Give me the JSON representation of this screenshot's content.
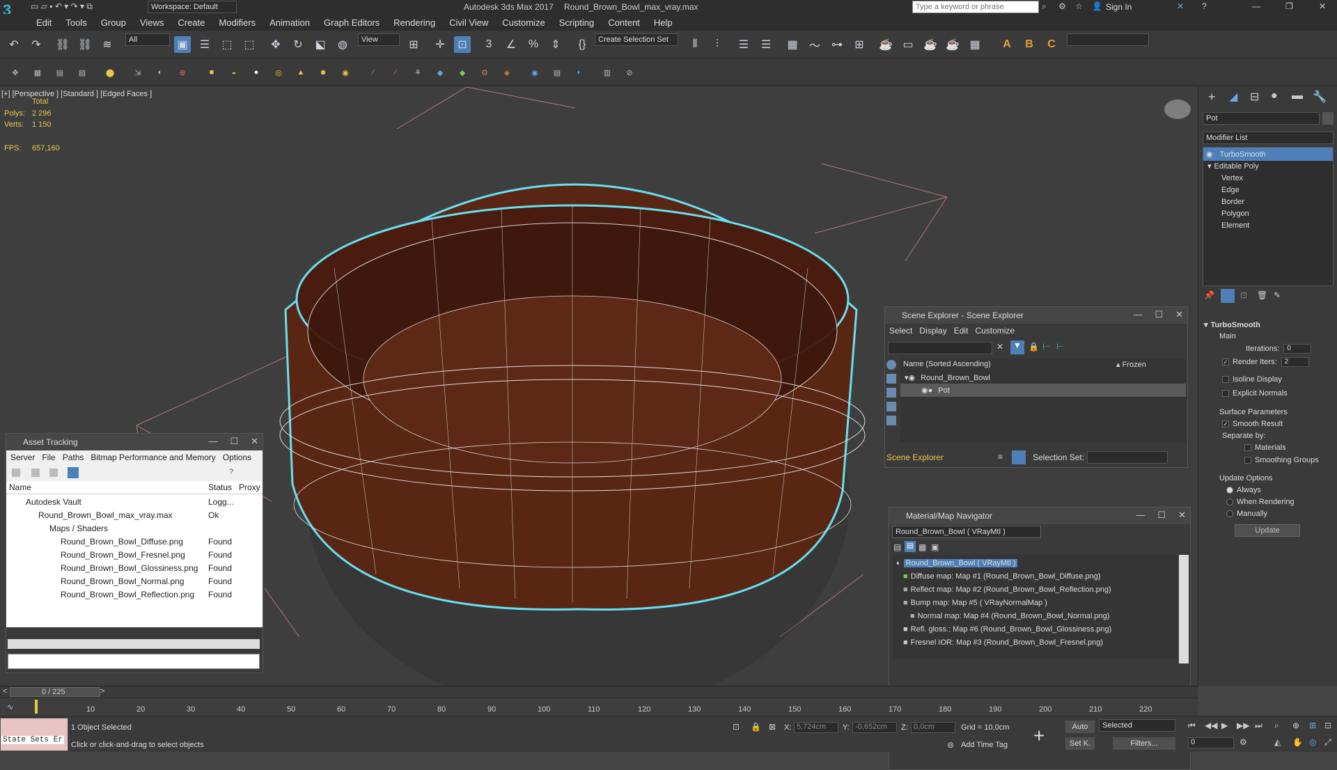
{
  "titlebar": {
    "app_title": "Autodesk 3ds Max 2017",
    "file_title": "Round_Brown_Bowl_max_vray.max",
    "workspace": "Workspace: Default",
    "search_placeholder": "Type a keyword or phrase",
    "sign_in": "Sign In"
  },
  "menu": [
    "Edit",
    "Tools",
    "Group",
    "Views",
    "Create",
    "Modifiers",
    "Animation",
    "Graph Editors",
    "Rendering",
    "Civil View",
    "Customize",
    "Scripting",
    "Content",
    "Help"
  ],
  "toolbar": {
    "filter_value": "All",
    "view_value": "View",
    "selection_set": "Create Selection Set"
  },
  "viewport": {
    "label": "[+] [Perspective ] [Standard ] [Edged Faces ]",
    "stats_total": "Total",
    "polys_label": "Polys:",
    "polys_value": "2 296",
    "verts_label": "Verts:",
    "verts_value": "1 150",
    "fps_label": "FPS:",
    "fps_value": "657,160"
  },
  "command_panel": {
    "object_name": "Pot",
    "modifier_list": "Modifier List",
    "stack": [
      "TurboSmooth",
      "Editable Poly",
      "Vertex",
      "Edge",
      "Border",
      "Polygon",
      "Element"
    ],
    "rollout_title": "TurboSmooth",
    "main_label": "Main",
    "iterations_label": "Iterations:",
    "iterations_value": "0",
    "render_iters_label": "Render Iters:",
    "render_iters_value": "2",
    "isoline": "Isoline Display",
    "explicit_normals": "Explicit Normals",
    "surface_params": "Surface Parameters",
    "smooth_result": "Smooth Result",
    "separate_by": "Separate by:",
    "materials": "Materials",
    "smoothing_groups": "Smoothing Groups",
    "update_options": "Update Options",
    "always": "Always",
    "when_rendering": "When Rendering",
    "manually": "Manually",
    "update_btn": "Update"
  },
  "scene_explorer": {
    "title": "Scene Explorer - Scene Explorer",
    "menu": [
      "Select",
      "Display",
      "Edit",
      "Customize"
    ],
    "col_name": "Name (Sorted Ascending)",
    "col_frozen": "▴ Frozen",
    "items": [
      "Round_Brown_Bowl",
      "Pot"
    ],
    "footer_label": "Scene Explorer",
    "selection_set_label": "Selection Set:"
  },
  "asset_tracking": {
    "title": "Asset Tracking",
    "menu": [
      "Server",
      "File",
      "Paths",
      "Bitmap Performance and Memory",
      "Options"
    ],
    "headers": [
      "Name",
      "Status",
      "Proxy"
    ],
    "rows": [
      {
        "name": "Autodesk Vault",
        "status": "Logg..."
      },
      {
        "name": "Round_Brown_Bowl_max_vray.max",
        "status": "Ok"
      },
      {
        "name": "Maps / Shaders",
        "status": ""
      },
      {
        "name": "Round_Brown_Bowl_Diffuse.png",
        "status": "Found"
      },
      {
        "name": "Round_Brown_Bowl_Fresnel.png",
        "status": "Found"
      },
      {
        "name": "Round_Brown_Bowl_Glossiness.png",
        "status": "Found"
      },
      {
        "name": "Round_Brown_Bowl_Normal.png",
        "status": "Found"
      },
      {
        "name": "Round_Brown_Bowl_Reflection.png",
        "status": "Found"
      }
    ]
  },
  "material_nav": {
    "title": "Material/Map Navigator",
    "field_value": "Round_Brown_Bowl  ( VRayMtl )",
    "items": [
      "Round_Brown_Bowl  ( VRayMtl )",
      "Diffuse map: Map #1 (Round_Brown_Bowl_Diffuse.png)",
      "Reflect map: Map #2 (Round_Brown_Bowl_Reflection.png)",
      "Bump map: Map #5  ( VRayNormalMap )",
      "Normal map: Map #4 (Round_Brown_Bowl_Normal.png)",
      "Refl. gloss.: Map #6 (Round_Brown_Bowl_Glossiness.png)",
      "Fresnel IOR: Map #3 (Round_Brown_Bowl_Fresnel.png)"
    ]
  },
  "timeline": {
    "frame": "0 / 225",
    "ticks": [
      "10",
      "20",
      "30",
      "40",
      "50",
      "60",
      "70",
      "80",
      "90",
      "100",
      "110",
      "120",
      "130",
      "140",
      "150",
      "160",
      "170",
      "180",
      "190",
      "200",
      "210",
      "220"
    ]
  },
  "status": {
    "state_sets": "State Sets Er",
    "selected": "1 Object Selected",
    "hint": "Click or click-and-drag to select objects",
    "x_label": "X:",
    "x_value": "5,724cm",
    "y_label": "Y:",
    "y_value": "-0,652cm",
    "z_label": "Z:",
    "z_value": "0,0cm",
    "grid": "Grid = 10,0cm",
    "add_time_tag": "Add Time Tag",
    "auto": "Auto",
    "set_k": "Set K.",
    "selected_dd": "Selected",
    "filters": "Filters...",
    "frame_field": "0"
  }
}
